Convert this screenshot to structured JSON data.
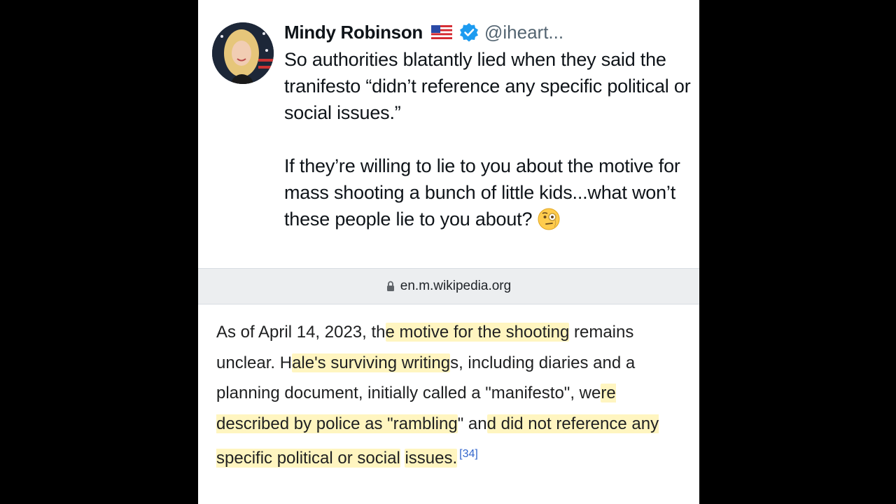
{
  "tweet": {
    "display_name": "Mindy Robinson",
    "handle": "@iheart...",
    "flag_icon": "us-flag-icon",
    "verified_icon": "verified-badge-icon",
    "paragraph1": "So authorities blatantly lied when they said the tranifesto “didn’t reference any specific political or social issues.”",
    "paragraph2": "If they’re willing to lie to you about the motive for mass shooting a bunch of little kids...what won’t these people lie to you about?",
    "emoji_icon": "face-with-monocle-emoji"
  },
  "link_preview": {
    "lock_icon": "lock-icon",
    "domain": "en.m.wikipedia.org"
  },
  "wiki": {
    "seg1": "As of April 14, 2023, th",
    "seg2": "e motive for the shooting",
    "seg3": " remains unclear. H",
    "seg4": "ale's surviving writing",
    "seg5": "s, including diaries and a planning document, initially called a \"manifesto\", we",
    "seg6": "re described by police as \"rambling",
    "seg7": "\" an",
    "seg8": "d did not reference any specific political or social",
    "seg9": " ",
    "seg10": "issues.",
    "citation": "[34]",
    "highlight_color": "#fff29a"
  },
  "colors": {
    "side_bars": "#000000",
    "name_text": "#0f1419",
    "handle_text": "#536471",
    "verified_blue": "#1d9bf0",
    "link_bar_bg": "#eceef0",
    "citation_blue": "#3366cc"
  }
}
